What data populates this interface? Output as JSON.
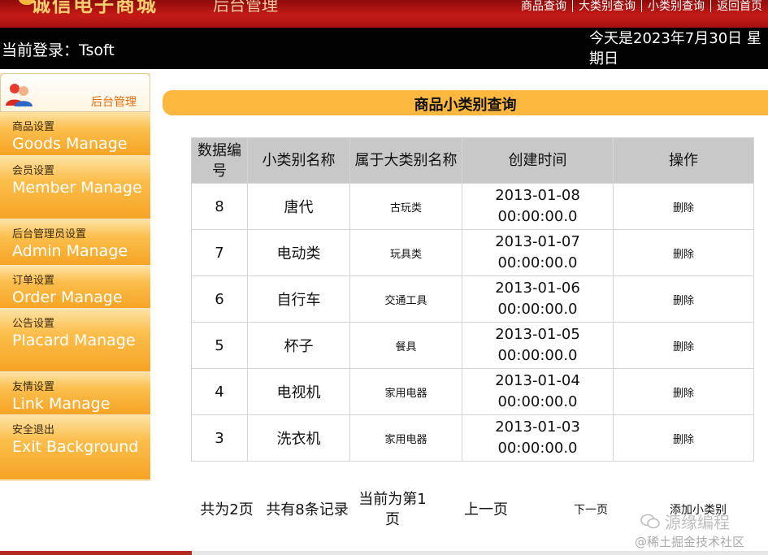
{
  "header": {
    "logo_text": "诚信电子商城",
    "logo_sub": "后台管理",
    "nav": [
      "商品查询",
      "大类别查询",
      "小类别查询",
      "返回首页"
    ]
  },
  "loginbar": {
    "login_text": "当前登录：Tsoft",
    "date_text": "今天是2023年7月30日 星期日"
  },
  "sidebar": {
    "title": "后台管理",
    "items": [
      {
        "cn": "商品设置",
        "en": "Goods Manage"
      },
      {
        "cn": "会员设置",
        "en": "Member Manage"
      },
      {
        "cn": "后台管理员设置",
        "en": "Admin Manage"
      },
      {
        "cn": "订单设置",
        "en": "Order Manage"
      },
      {
        "cn": "公告设置",
        "en": "Placard Manage"
      },
      {
        "cn": "友情设置",
        "en": "Link Manage"
      },
      {
        "cn": "安全退出",
        "en": "Exit Background"
      }
    ]
  },
  "page_title": "商品小类别查询",
  "table": {
    "headers": [
      "数据编号",
      "小类别名称",
      "属于大类别名称",
      "创建时间",
      "操作"
    ],
    "rows": [
      {
        "id": "8",
        "name": "唐代",
        "category": "古玩类",
        "created": "2013-01-08 00:00:00.0",
        "action": "删除"
      },
      {
        "id": "7",
        "name": "电动类",
        "category": "玩具类",
        "created": "2013-01-07 00:00:00.0",
        "action": "删除"
      },
      {
        "id": "6",
        "name": "自行车",
        "category": "交通工具",
        "created": "2013-01-06 00:00:00.0",
        "action": "删除"
      },
      {
        "id": "5",
        "name": "杯子",
        "category": "餐具",
        "created": "2013-01-05 00:00:00.0",
        "action": "删除"
      },
      {
        "id": "4",
        "name": "电视机",
        "category": "家用电器",
        "created": "2013-01-04 00:00:00.0",
        "action": "删除"
      },
      {
        "id": "3",
        "name": "洗衣机",
        "category": "家用电器",
        "created": "2013-01-03 00:00:00.0",
        "action": "删除"
      }
    ]
  },
  "pager": {
    "total_pages": "共为2页",
    "total_records": "共有8条记录",
    "current_page": "当前为第1页",
    "prev": "上一页",
    "next": "下一页",
    "add": "添加小类别"
  },
  "watermark": {
    "brand": "源缘编程",
    "community": "@稀土掘金技术社区"
  }
}
